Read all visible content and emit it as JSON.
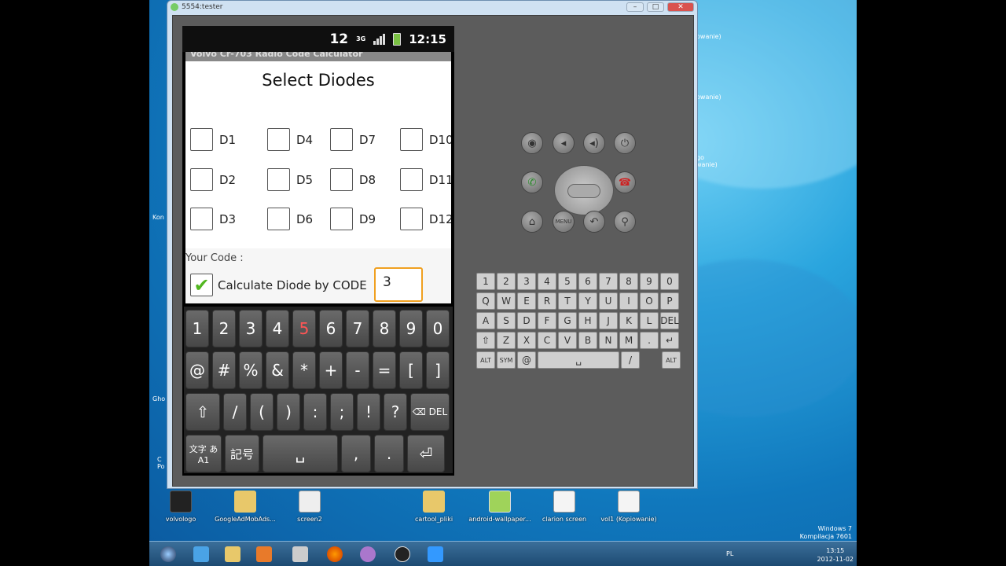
{
  "window": {
    "title": "5554:tester"
  },
  "phone": {
    "status": {
      "notif": "12",
      "network": "3G",
      "time": "12:15"
    },
    "app": {
      "title_partial": "Volvo Cr-703 Radio Code Calculator",
      "heading": "Select Diodes",
      "diodes": [
        "D1",
        "D4",
        "D7",
        "D10",
        "D2",
        "D5",
        "D8",
        "D11",
        "D3",
        "D6",
        "D9",
        "D12"
      ],
      "your_code_label": "Your Code :",
      "calc_label": "Calculate Diode by CODE",
      "calc_checked": true,
      "code_value": "3"
    },
    "keyboard": {
      "row1": [
        "1",
        "2",
        "3",
        "4",
        "5",
        "6",
        "7",
        "8",
        "9",
        "0"
      ],
      "row2": [
        "@",
        "#",
        "%",
        "&",
        "*",
        "+",
        "-",
        "=",
        "[",
        "]"
      ],
      "row3": [
        "⇧",
        "/",
        "(",
        ")",
        ":",
        ";",
        "!",
        "?",
        "⌫ DEL"
      ],
      "row4": [
        "文字 あA1",
        "記号",
        "␣",
        ",",
        ".",
        " ⏎"
      ]
    }
  },
  "controls": {
    "qwerty": {
      "r1": [
        "1",
        "2",
        "3",
        "4",
        "5",
        "6",
        "7",
        "8",
        "9",
        "0"
      ],
      "r1_sym": [
        "!",
        "@",
        "#",
        "$",
        "%",
        "^",
        "&",
        "*",
        "(",
        ")"
      ],
      "r2": [
        "Q",
        "W",
        "E",
        "R",
        "T",
        "Y",
        "U",
        "I",
        "O",
        "P"
      ],
      "r3": [
        "A",
        "S",
        "D",
        "F",
        "G",
        "H",
        "J",
        "K",
        "L",
        "DEL"
      ],
      "r4": [
        "⇧",
        "Z",
        "X",
        "C",
        "V",
        "B",
        "N",
        "M",
        ".",
        "↵"
      ],
      "r5": [
        "ALT",
        "SYM",
        "@",
        "␣",
        "/",
        "ALT"
      ]
    }
  },
  "desktop": {
    "icons": [
      "volvologo",
      "GoogleAdMobAds...",
      "screen2",
      "cartool_pliki",
      "android-wallpaper...",
      "clarion screen",
      "vol1 (Kopiowanie)"
    ],
    "side_labels": [
      "owanie)",
      "owanie)",
      "go\nwanie)",
      "Kon",
      "Gho",
      "C\nPo"
    ],
    "watermark": [
      "Windows 7",
      "Kompilacja 7601"
    ]
  },
  "taskbar": {
    "lang": "PL",
    "time": "13:15",
    "date": "2012-11-02"
  },
  "colors": {
    "accent_orange": "#f0a020",
    "check_green": "#52b720",
    "win_blue": "#1078bd"
  }
}
